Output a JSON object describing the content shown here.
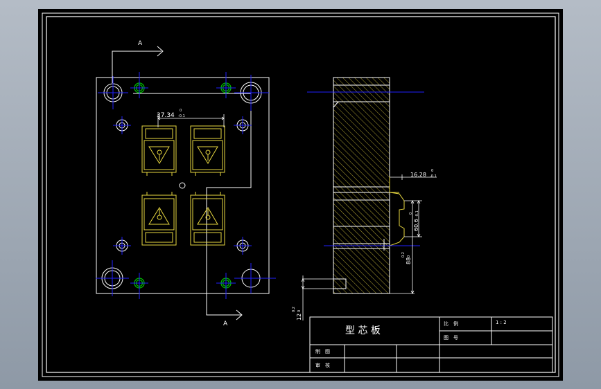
{
  "colors": {
    "background": "#000000",
    "frame": "#ffffff",
    "centerline": "#2020ff",
    "bushing": "#00c000",
    "cavity": "#e8d840",
    "outline": "#ffffff"
  },
  "section": {
    "marker_top": "A",
    "marker_bottom": "A"
  },
  "dimensions": {
    "cavity_pitch": "37.34",
    "cavity_pitch_tol_upper": "0",
    "cavity_pitch_tol_lower": "-0.1",
    "step_width": "16.28",
    "step_width_tol_upper": "0",
    "step_width_tol_lower": "-0.1",
    "step_height": "60.6",
    "step_height_tol_upper": "0",
    "step_height_tol_lower": "-0.1",
    "plate_height": "88",
    "plate_height_tol_upper": "0.2",
    "plate_height_tol_lower": "0",
    "base_height": "12",
    "base_height_tol_upper": "0.2",
    "base_height_tol_lower": "0"
  },
  "title_block": {
    "part_name": "型 芯 板",
    "scale_label": "比　例",
    "scale_value": "1 : 2",
    "drawing_no_label": "图　号",
    "drawn_by_label": "制　图",
    "checked_by_label": "审　核"
  }
}
